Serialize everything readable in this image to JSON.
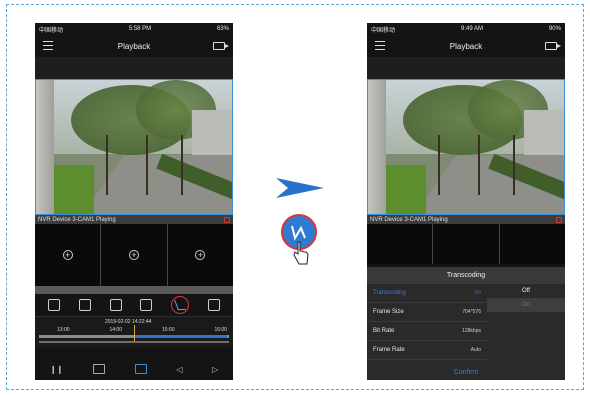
{
  "phones": {
    "a": {
      "status": {
        "carrier": "中国移动",
        "time": "5:58 PM",
        "battery": "63%"
      },
      "title": "Playback",
      "camera_label": "NVR Device 3-CAM1 Playing",
      "timeline": {
        "datetime": "2019-02-02 14:22:44",
        "marks": [
          "13:00",
          "14:00",
          "15:00",
          "16:00"
        ]
      }
    },
    "b": {
      "status": {
        "carrier": "中国移动",
        "time": "9:49 AM",
        "battery": "90%"
      },
      "title": "Playback",
      "camera_label": "NVR Device 3-CAM1 Playing",
      "sheet": {
        "title": "Transcoding",
        "rows": [
          {
            "label": "Transcoding",
            "value": "On"
          },
          {
            "label": "Frame Size",
            "value": "704*576"
          },
          {
            "label": "Bit Rate",
            "value": "128kbps"
          },
          {
            "label": "Frame Rate",
            "value": "Auto"
          }
        ],
        "options": [
          "Off",
          "On"
        ],
        "confirm": "Confirm"
      }
    }
  },
  "colors": {
    "accent": "#2f80e0",
    "highlight": "#e0333c",
    "arrow": "#2a72c9"
  },
  "icons": [
    "menu-icon",
    "camera-icon",
    "snapshot-icon",
    "record-icon",
    "volume-icon",
    "zoom-icon",
    "transcoding-icon",
    "export-icon",
    "pause-icon",
    "stop-icon",
    "home-icon",
    "prev-icon",
    "next-icon",
    "hand-pointer-icon",
    "arrow-right-icon"
  ]
}
